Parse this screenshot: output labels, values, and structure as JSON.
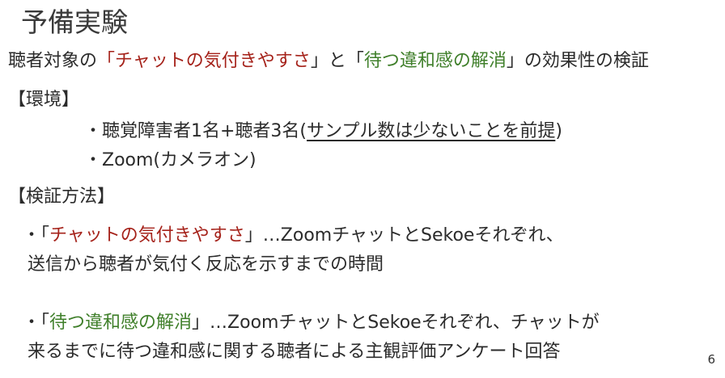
{
  "title": "予備実験",
  "subtitle": {
    "p1": "聴者対象の",
    "q1_open": "「",
    "q1_text": "チャットの気付きやすさ",
    "q1_close": "」",
    "mid": "と",
    "q2_open": "「",
    "q2_text": "待つ違和感の解消",
    "q2_close": "」",
    "p2": "の効果性の検証"
  },
  "env": {
    "heading": "【環境】",
    "item1_prefix": "・聴覚障害者1名+聴者3名(",
    "item1_underlined": "サンプル数は少ないことを前提",
    "item1_suffix": ")",
    "item2": "・Zoom(カメラオン)"
  },
  "method": {
    "heading": "【検証方法】",
    "b1_prefix": "・「",
    "b1_quote": "チャットの気付きやすさ",
    "b1_rest": "」…ZoomチャットとSekoeそれぞれ、",
    "b1_line2": "送信から聴者が気付く反応を示すまでの時間",
    "b2_prefix": "・「",
    "b2_quote": "待つ違和感の解消",
    "b2_rest": "」…ZoomチャットとSekoeそれぞれ、チャットが",
    "b2_line2": "来るまでに待つ違和感に関する聴者による主観評価アンケート回答"
  },
  "page_number": "6",
  "colors": {
    "red": "#a5221a",
    "green": "#3f7f2a",
    "text": "#2b2b2b"
  }
}
